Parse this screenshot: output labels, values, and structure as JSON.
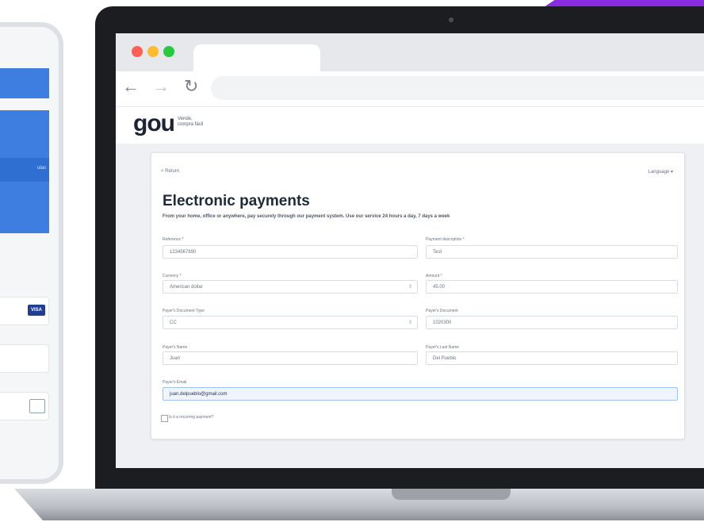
{
  "colors": {
    "accent": "#8a2be2",
    "phone_blue": "#3d7ee0",
    "input_focus_bg": "#eef5fe"
  },
  "phone": {
    "stripe_text": "ulas",
    "visa_label": "VISA"
  },
  "browser": {
    "back_icon": "arrow-left-icon",
    "forward_icon": "arrow-right-icon",
    "reload_icon": "reload-icon"
  },
  "site": {
    "logo": "gou",
    "tagline_line1": "Vende,",
    "tagline_line2": "compra fácil"
  },
  "form": {
    "return_label": "< Return",
    "language_label": "Language ▾",
    "title": "Electronic payments",
    "subtitle": "From your home, office or anywhere, pay securely through our payment system. Use our service 24 hours a day, 7 days a week",
    "fields": {
      "reference": {
        "label": "Reference *",
        "value": "1234567890"
      },
      "payment_description": {
        "label": "Payment description *",
        "value": "Test"
      },
      "currency": {
        "label": "Currency *",
        "value": "American dollar"
      },
      "amount": {
        "label": "Amount *",
        "value": "45.00"
      },
      "doc_type": {
        "label": "Payer's Document Type",
        "value": "CC"
      },
      "document": {
        "label": "Payer's Document",
        "value": "1020300"
      },
      "name": {
        "label": "Payer's Name",
        "value": "Juan"
      },
      "last_name": {
        "label": "Payer's Last Name",
        "value": "Del Pueblo"
      },
      "email": {
        "label": "Payer's Email",
        "value": "juan.delpueblo@gmail.com"
      }
    },
    "recurring_label": "Is it a recurring payment?"
  }
}
